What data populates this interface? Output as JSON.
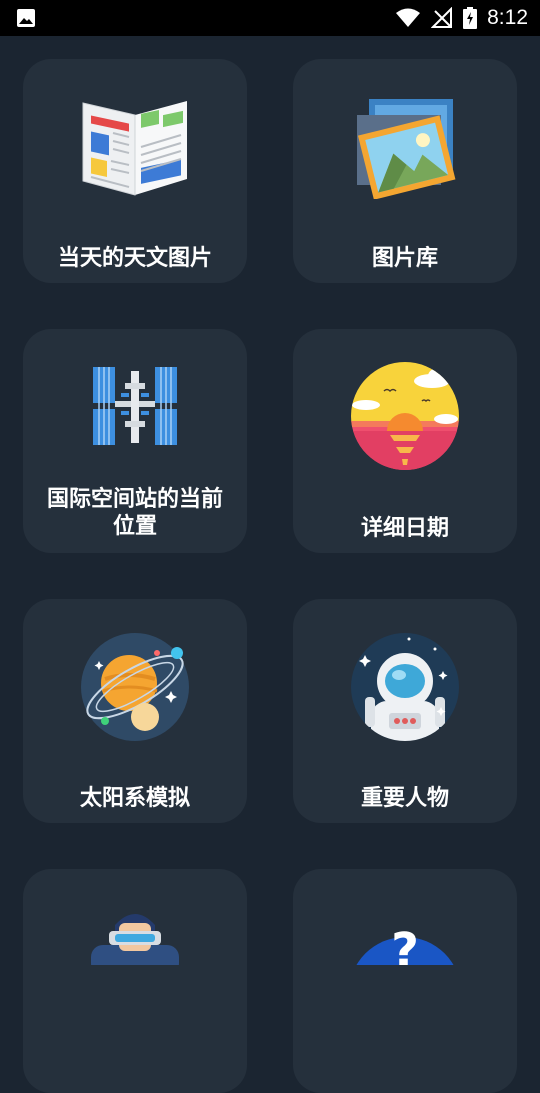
{
  "status_bar": {
    "time": "8:12"
  },
  "cards": [
    {
      "label": "当天的天文图片",
      "icon": "newspaper-icon"
    },
    {
      "label": "图片库",
      "icon": "photo-gallery-icon"
    },
    {
      "label": "国际空间站的当前\n位置",
      "icon": "space-station-icon"
    },
    {
      "label": "详细日期",
      "icon": "sunset-icon"
    },
    {
      "label": "太阳系模拟",
      "icon": "solar-system-icon"
    },
    {
      "label": "重要人物",
      "icon": "astronaut-icon"
    },
    {
      "label": "",
      "icon": "vr-person-icon"
    },
    {
      "label": "",
      "icon": "question-icon"
    }
  ]
}
